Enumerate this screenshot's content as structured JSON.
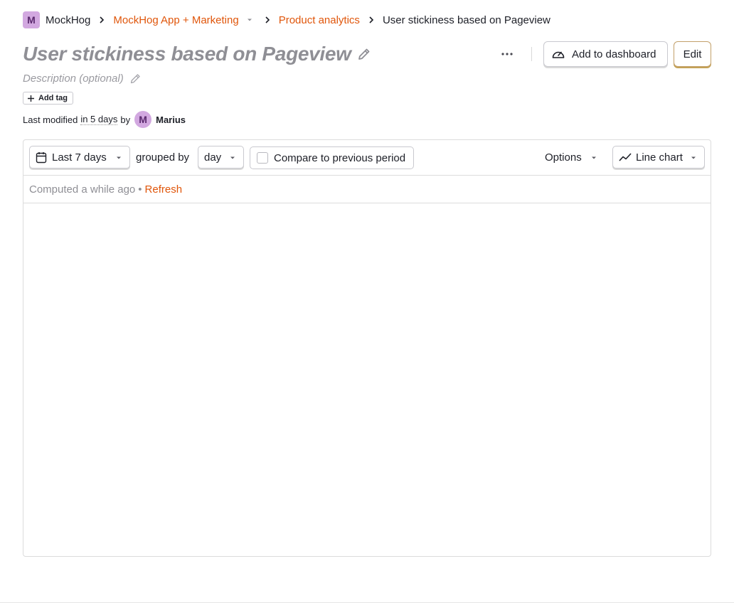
{
  "breadcrumb": {
    "org_initial": "M",
    "org_name": "MockHog",
    "project": "MockHog App + Marketing",
    "section": "Product analytics",
    "current": "User stickiness based on Pageview"
  },
  "insight": {
    "title": "User stickiness based on Pageview",
    "description_placeholder": "Description (optional)",
    "add_tag_label": "Add tag",
    "modified_prefix": "Last modified",
    "modified_when": "in 5 days",
    "modified_by": "by",
    "user_initial": "M",
    "user_name": "Marius"
  },
  "actions": {
    "add_to_dashboard": "Add to dashboard",
    "edit": "Edit"
  },
  "toolbar": {
    "date_range": "Last 7 days",
    "grouped_by_label": "grouped by",
    "interval": "day",
    "compare_label": "Compare to previous period",
    "options_label": "Options",
    "chart_type": "Line chart"
  },
  "status": {
    "computed": "Computed a while ago",
    "bullet": "•",
    "refresh": "Refresh"
  },
  "colors": {
    "accent": "#e0560b",
    "avatar_bg": "#d2a8e0",
    "title_muted": "#8f8f95"
  }
}
